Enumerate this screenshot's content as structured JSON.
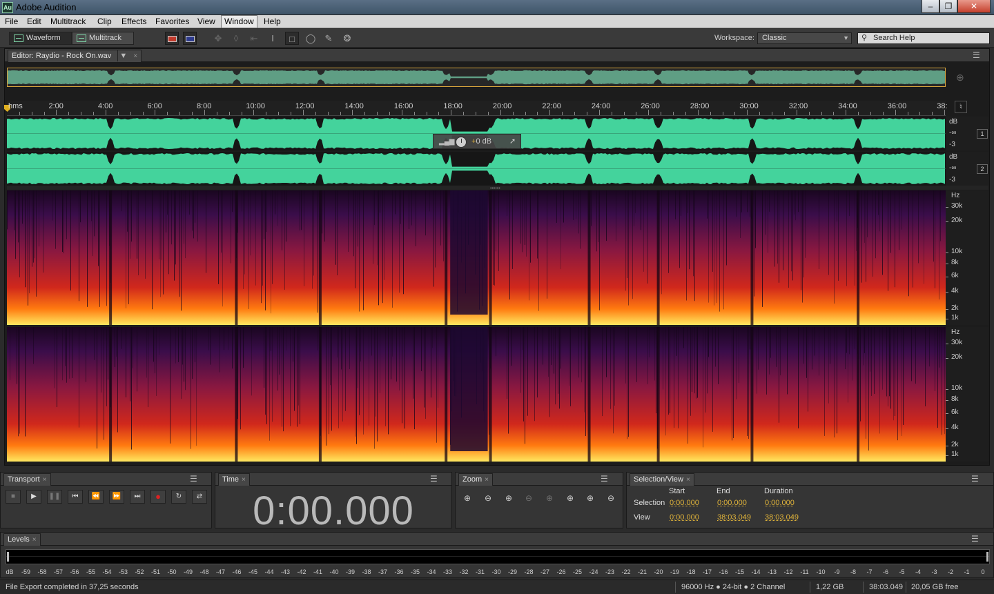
{
  "window": {
    "app_icon": "Au",
    "title": "Adobe Audition",
    "minimize_icon": "minimize-icon",
    "maximize_icon": "maximize-icon",
    "close_icon": "close-icon"
  },
  "menubar": {
    "items": [
      "File",
      "Edit",
      "Multitrack",
      "Clip",
      "Effects",
      "Favorites",
      "View",
      "Window",
      "Help"
    ],
    "active": "Window"
  },
  "toolbar": {
    "waveform_label": "Waveform",
    "multitrack_label": "Multitrack",
    "active_mode": "Waveform",
    "tools": [
      "spectral-view-toggle",
      "spectral-pitch-toggle",
      "move-tool",
      "razor-tool",
      "slip-tool",
      "time-selection-tool",
      "marquee-selection-tool",
      "lasso-selection-tool",
      "paintbrush-selection-tool",
      "spot-healing-brush-tool"
    ],
    "workspace_label": "Workspace:",
    "workspace_value": "Classic",
    "search_placeholder": "Search Help"
  },
  "editor": {
    "tab_label": "Editor: Raydio - Rock On.wav",
    "ruler": {
      "unit_label": "hms",
      "ticks": [
        "2:00",
        "4:00",
        "6:00",
        "8:00",
        "10:00",
        "12:00",
        "14:00",
        "16:00",
        "18:00",
        "20:00",
        "22:00",
        "24:00",
        "26:00",
        "28:00",
        "30:00",
        "32:00",
        "34:00",
        "36:00",
        "38:"
      ],
      "tick_minutes": [
        2,
        4,
        6,
        8,
        10,
        12,
        14,
        16,
        18,
        20,
        22,
        24,
        26,
        28,
        30,
        32,
        34,
        36,
        38
      ],
      "total_minutes": 38.05
    },
    "waveform_axis": {
      "unit": "dB",
      "labels": [
        "dB",
        "-∞",
        "-3"
      ],
      "channels": [
        "1",
        "2"
      ]
    },
    "hud": {
      "volume_prefix": "+",
      "volume_value": "0 dB",
      "pin_icon": "pin-icon",
      "meter_icon": "volume-meter-icon",
      "knob_icon": "volume-knob-icon"
    },
    "spectral_axis": {
      "unit": "Hz",
      "labels": [
        "30k",
        "20k",
        "10k",
        "8k",
        "6k",
        "4k",
        "2k",
        "1k"
      ]
    },
    "song_breaks_minutes": [
      4.2,
      9.3,
      12.7,
      17.8,
      19.6,
      23.6,
      26.4,
      30.2,
      34.5
    ]
  },
  "transport": {
    "tab_label": "Transport",
    "buttons": [
      "stop",
      "play",
      "pause",
      "move-to-previous",
      "rewind",
      "fast-forward",
      "move-to-next",
      "record",
      "loop-playback",
      "skip-selection"
    ]
  },
  "time": {
    "tab_label": "Time",
    "value": "0:00.000"
  },
  "zoom": {
    "tab_label": "Zoom",
    "buttons": [
      "zoom-in-amplitude",
      "zoom-out-amplitude",
      "zoom-in-time",
      "zoom-out-full",
      "zoom-to-selection",
      "zoom-in-left",
      "zoom-in-right",
      "zoom-out-both"
    ]
  },
  "selection_view": {
    "tab_label": "Selection/View",
    "columns": [
      "Start",
      "End",
      "Duration"
    ],
    "rows": [
      {
        "label": "Selection",
        "start": "0:00.000",
        "end": "0:00.000",
        "duration": "0:00.000"
      },
      {
        "label": "View",
        "start": "0:00.000",
        "end": "38:03.049",
        "duration": "38:03.049"
      }
    ]
  },
  "levels": {
    "tab_label": "Levels",
    "scale": [
      "dB",
      "-59",
      "-58",
      "-57",
      "-56",
      "-55",
      "-54",
      "-53",
      "-52",
      "-51",
      "-50",
      "-49",
      "-48",
      "-47",
      "-46",
      "-45",
      "-44",
      "-43",
      "-42",
      "-41",
      "-40",
      "-39",
      "-38",
      "-37",
      "-36",
      "-35",
      "-34",
      "-33",
      "-32",
      "-31",
      "-30",
      "-29",
      "-28",
      "-27",
      "-26",
      "-25",
      "-24",
      "-23",
      "-22",
      "-21",
      "-20",
      "-19",
      "-18",
      "-17",
      "-16",
      "-15",
      "-14",
      "-13",
      "-12",
      "-11",
      "-10",
      "-9",
      "-8",
      "-7",
      "-6",
      "-5",
      "-4",
      "-3",
      "-2",
      "-1",
      "0"
    ]
  },
  "status": {
    "message": "File Export completed in 37,25 seconds",
    "format": "96000 Hz ● 24-bit ● 2 Channel",
    "file_size": "1,22 GB",
    "duration": "38:03.049",
    "free_space": "20,05 GB free"
  },
  "colors": {
    "waveform": "#44d39c",
    "selection_value": "#e1b43a",
    "overview_border": "#d6a43c",
    "playhead": "#e0b020",
    "spectral_low": "#130514",
    "spectral_high": "#ffe860"
  }
}
